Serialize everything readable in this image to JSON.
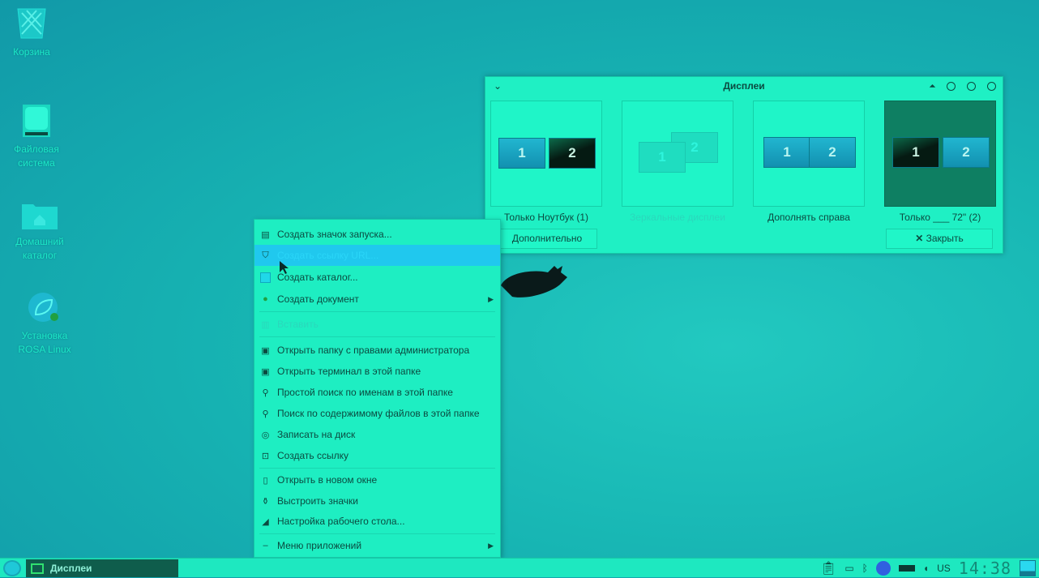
{
  "desktop": {
    "icons": [
      {
        "label": "Корзина",
        "icon": "trash-icon"
      },
      {
        "label": "Файловая система",
        "icon": "drive-icon"
      },
      {
        "label": "Домашний каталог",
        "icon": "home-folder-icon"
      },
      {
        "label": "Установка ROSA Linux",
        "icon": "installer-icon"
      }
    ]
  },
  "dialog": {
    "title": "Дисплеи",
    "options": [
      {
        "label": "Только Ноутбук (1)",
        "m1": "1",
        "m2": "2"
      },
      {
        "label": "Зеркальные дисплеи",
        "m1": "1",
        "m2": "2"
      },
      {
        "label": "Дополнять справа",
        "m1": "1",
        "m2": "2"
      },
      {
        "label": "Только ___ 72\" (2)",
        "m1": "1",
        "m2": "2"
      }
    ],
    "advanced_label": "Дополнительно",
    "close_label": "Закрыть"
  },
  "menu": {
    "items": [
      {
        "label": "Создать значок запуска..."
      },
      {
        "label": "Создать ссылку URL..."
      },
      {
        "label": "Создать каталог..."
      },
      {
        "label": "Создать документ"
      },
      {
        "label": "Вставить"
      },
      {
        "label": "Открыть папку с правами администратора"
      },
      {
        "label": "Открыть терминал в этой папке"
      },
      {
        "label": "Простой поиск по именам в этой папке"
      },
      {
        "label": "Поиск по содержимому файлов в этой папке"
      },
      {
        "label": "Записать на диск"
      },
      {
        "label": "Создать ссылку"
      },
      {
        "label": "Открыть в новом окне"
      },
      {
        "label": "Выстроить значки"
      },
      {
        "label": "Настройка рабочего стола..."
      },
      {
        "label": "Меню приложений"
      }
    ]
  },
  "taskbar": {
    "task_label": "Дисплеи",
    "keyboard_layout": "US",
    "clock": "14:38"
  }
}
